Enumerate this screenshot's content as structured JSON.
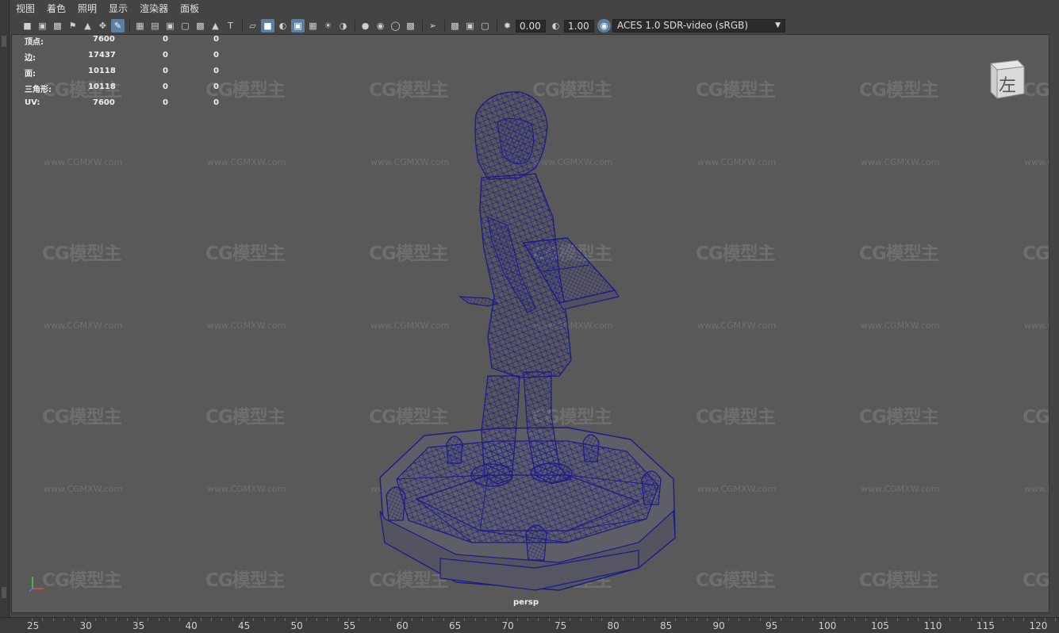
{
  "menu": [
    "视图",
    "着色",
    "照明",
    "显示",
    "渲染器",
    "面板"
  ],
  "toolbar": {
    "icons_group1": [
      "camera-icon",
      "camera-attributes-icon",
      "bookmark-camera-icon",
      "bookmark-icon",
      "image-plane-icon",
      "2d-pan-zoom-icon",
      "grease-pencil-icon"
    ],
    "icons_group2": [
      "grid-icon",
      "film-gate-icon",
      "resolution-gate-icon",
      "gate-mask-icon",
      "field-chart-icon",
      "safe-title-icon"
    ],
    "icons_group3": [
      "wireframe-icon",
      "smooth-shade-icon",
      "default-material-icon",
      "wireframe-on-shaded-icon",
      "textured-icon",
      "use-lights-icon",
      "shadows-icon"
    ],
    "icons_group4": [
      "screen-space-ao-icon",
      "motion-blur-icon",
      "anti-aliasing-icon",
      "depth-of-field-icon",
      "isolate-select-icon",
      "xray-icon",
      "xray-joints-icon",
      "backface-icon"
    ],
    "exposure_value": "0.00",
    "gamma_value": "1.00",
    "color_space": "ACES 1.0 SDR-video (sRGB)"
  },
  "hud": {
    "rows": [
      {
        "label": "顶点:",
        "v1": "7600",
        "v2": "0",
        "v3": "0"
      },
      {
        "label": "边:",
        "v1": "17437",
        "v2": "0",
        "v3": "0"
      },
      {
        "label": "面:",
        "v1": "10118",
        "v2": "0",
        "v3": "0"
      },
      {
        "label": "三角形:",
        "v1": "10118",
        "v2": "0",
        "v3": "0"
      },
      {
        "label": "UV:",
        "v1": "7600",
        "v2": "0",
        "v3": "0"
      }
    ]
  },
  "viewcube": {
    "face_label": "左"
  },
  "camera_label": "persp",
  "watermark": {
    "logo": "CG模型主",
    "url": "www.CGMXW.com"
  },
  "timeline": {
    "labels": [
      "25",
      "30",
      "35",
      "40",
      "45",
      "50",
      "55",
      "60",
      "65",
      "70",
      "75",
      "80",
      "85",
      "90",
      "95",
      "100",
      "105",
      "110",
      "115",
      "120"
    ]
  },
  "colors": {
    "viewport_bg": "#595959",
    "wireframe": "#1a1a8c",
    "accent": "#5c7fa0"
  }
}
